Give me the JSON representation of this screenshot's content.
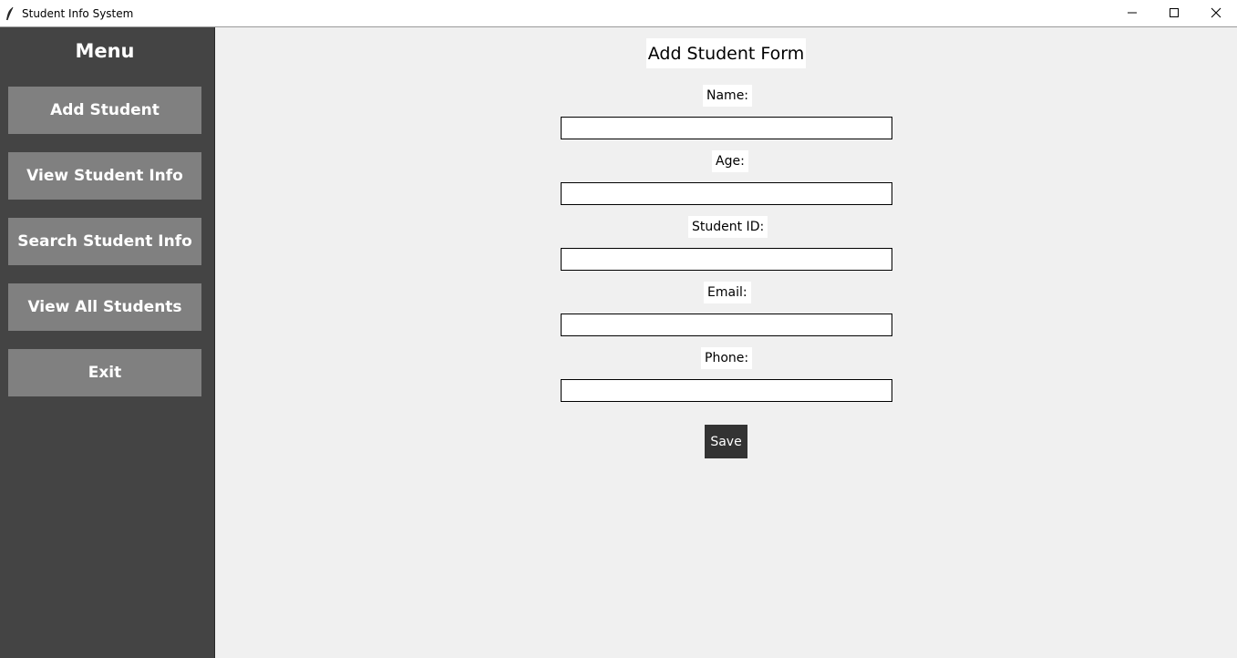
{
  "window": {
    "title": "Student Info System",
    "icon": "feather-icon",
    "controls": [
      "minimize-icon",
      "maximize-icon",
      "close-icon"
    ]
  },
  "sidebar": {
    "title": "Menu",
    "items": [
      {
        "label": "Add Student"
      },
      {
        "label": "View Student Info"
      },
      {
        "label": "Search Student Info"
      },
      {
        "label": "View All Students"
      },
      {
        "label": "Exit"
      }
    ]
  },
  "form": {
    "title": "Add Student Form",
    "fields": [
      {
        "label": "Name:",
        "value": ""
      },
      {
        "label": "Age:",
        "value": ""
      },
      {
        "label": "Student ID:",
        "value": ""
      },
      {
        "label": "Email:",
        "value": ""
      },
      {
        "label": "Phone:",
        "value": ""
      }
    ],
    "save_label": "Save"
  },
  "colors": {
    "sidebar_bg": "#444444",
    "menu_button_bg": "#808080",
    "main_bg": "#f0f0f0",
    "save_button_bg": "#333333"
  }
}
